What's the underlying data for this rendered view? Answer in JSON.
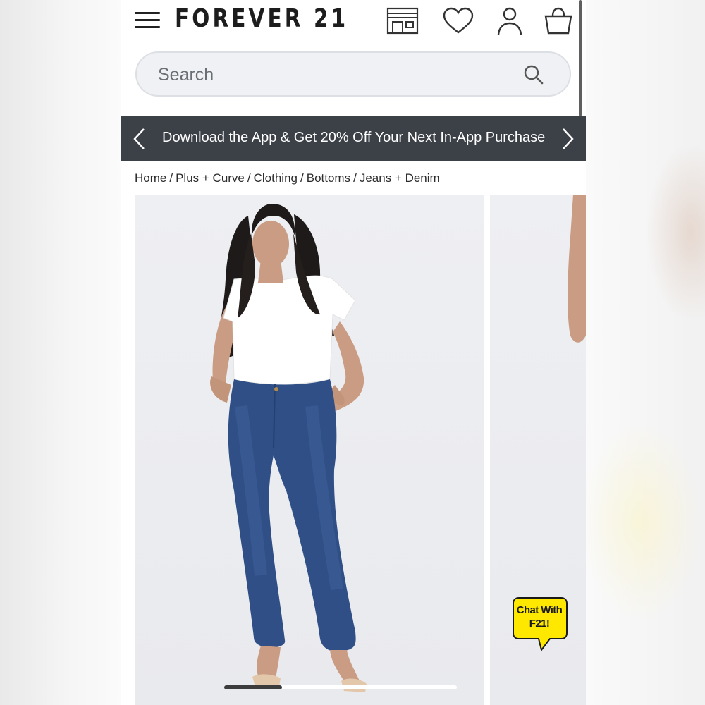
{
  "header": {
    "logo": "FOREVER 21",
    "icons": [
      "menu-icon",
      "store-icon",
      "heart-icon",
      "account-icon",
      "bag-icon"
    ]
  },
  "search": {
    "placeholder": "Search"
  },
  "promo": {
    "text": "Download the App & Get 20% Off Your Next In-App Purchase"
  },
  "breadcrumb": {
    "items": [
      "Home",
      "Plus + Curve",
      "Clothing",
      "Bottoms",
      "Jeans + Denim"
    ],
    "separator": "/"
  },
  "gallery": {
    "active_index": 0
  },
  "chat": {
    "line1": "Chat With",
    "line2": "F21!"
  },
  "colors": {
    "promo_bg": "#3c4047",
    "chat_bubble": "#ffe800",
    "denim": "#2f4f86"
  }
}
